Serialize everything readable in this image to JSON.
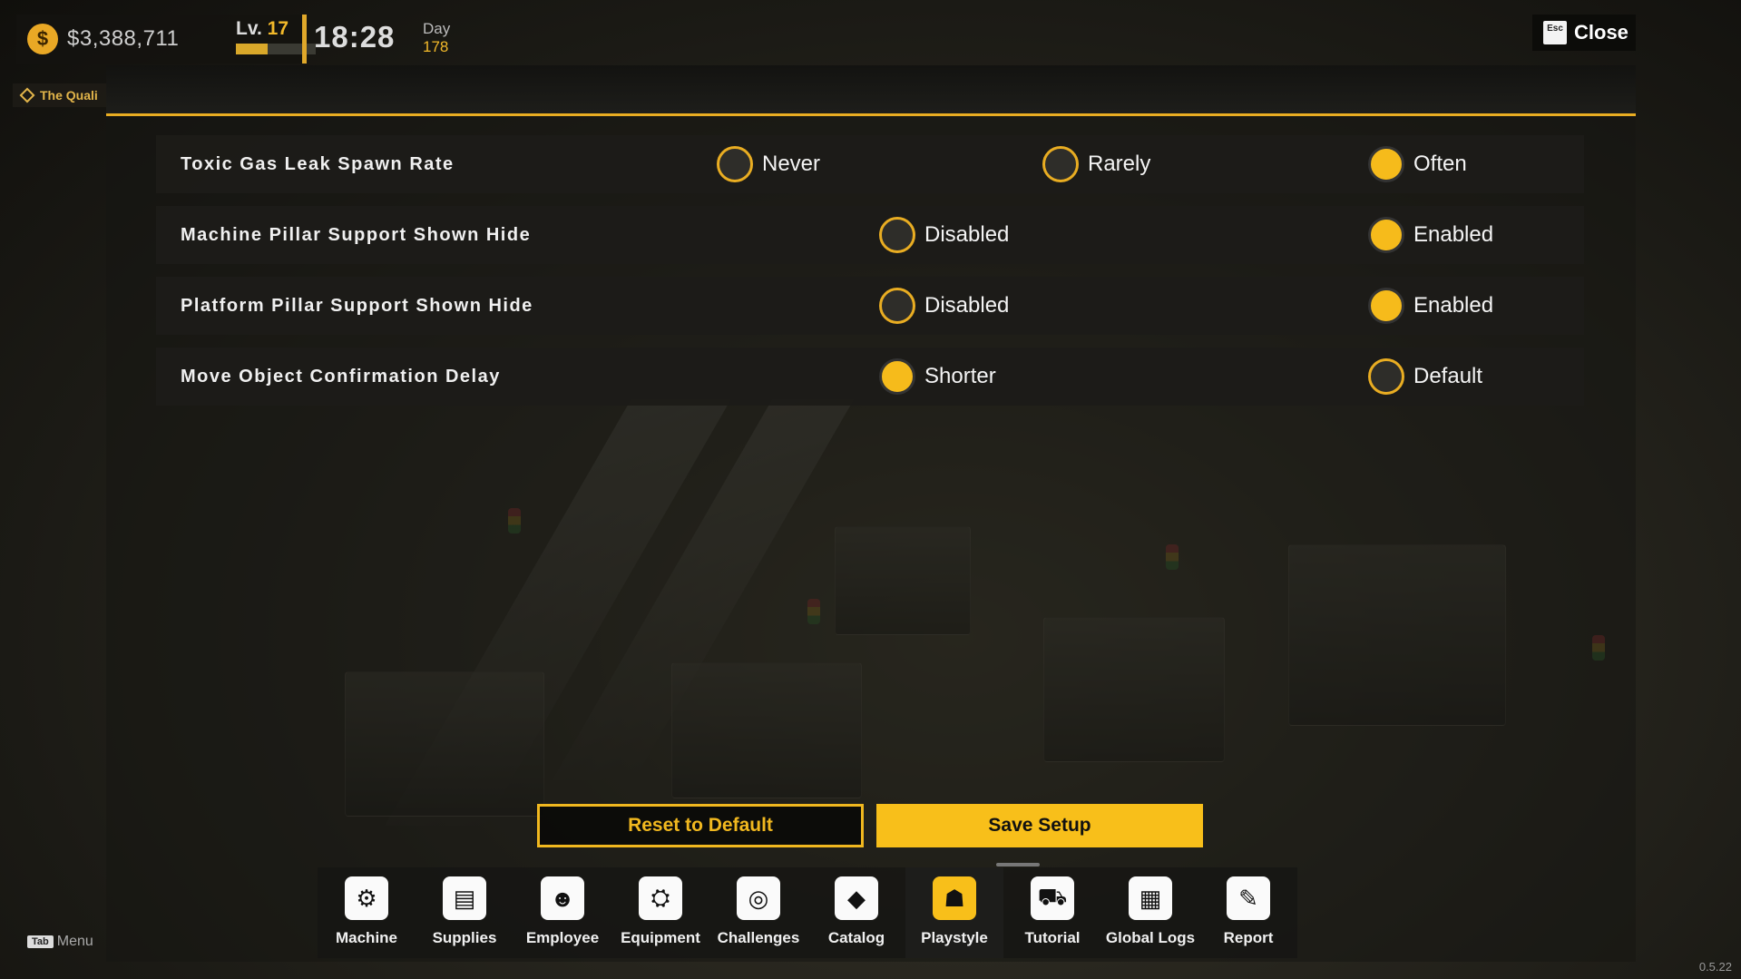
{
  "hud": {
    "money": "$3,388,711",
    "currency_symbol": "$",
    "level_prefix": "Lv.",
    "level": "17",
    "xp_progress": 0.4,
    "time": "18:28",
    "day_label": "Day",
    "day": "178",
    "quest": "The Quali",
    "close_key": "Esc",
    "close_label": "Close"
  },
  "settings": [
    {
      "label": "Toxic Gas Leak Spawn Rate",
      "options": [
        {
          "label": "Never",
          "selected": false
        },
        {
          "label": "Rarely",
          "selected": false
        },
        {
          "label": "Often",
          "selected": true
        }
      ]
    },
    {
      "label": "Machine Pillar Support Shown Hide",
      "options": [
        {
          "label": "Disabled",
          "selected": false
        },
        {
          "label": "Enabled",
          "selected": true
        }
      ]
    },
    {
      "label": "Platform Pillar Support Shown Hide",
      "options": [
        {
          "label": "Disabled",
          "selected": false
        },
        {
          "label": "Enabled",
          "selected": true
        }
      ]
    },
    {
      "label": "Move Object Confirmation Delay",
      "options": [
        {
          "label": "Shorter",
          "selected": true
        },
        {
          "label": "Default",
          "selected": false
        }
      ]
    }
  ],
  "buttons": {
    "reset": "Reset to Default",
    "save": "Save Setup"
  },
  "nav": [
    {
      "label": "Machine",
      "icon": "machine-icon",
      "glyph": "⚙",
      "active": false
    },
    {
      "label": "Supplies",
      "icon": "supplies-icon",
      "glyph": "▤",
      "active": false
    },
    {
      "label": "Employee",
      "icon": "employee-icon",
      "glyph": "☻",
      "active": false
    },
    {
      "label": "Equipment",
      "icon": "equipment-icon",
      "glyph": "⛭",
      "active": false
    },
    {
      "label": "Challenges",
      "icon": "challenges-icon",
      "glyph": "◎",
      "active": false
    },
    {
      "label": "Catalog",
      "icon": "diamond-icon",
      "glyph": "◆",
      "active": false
    },
    {
      "label": "Playstyle",
      "icon": "gamepad-icon",
      "glyph": "☗",
      "active": true
    },
    {
      "label": "Tutorial",
      "icon": "truck-icon",
      "glyph": "⛟",
      "active": false
    },
    {
      "label": "Global Logs",
      "icon": "logs-icon",
      "glyph": "▦",
      "active": false
    },
    {
      "label": "Report",
      "icon": "report-icon",
      "glyph": "✎",
      "active": false
    }
  ],
  "footer": {
    "tab_key": "Tab",
    "menu_label": "Menu",
    "version": "0.5.22"
  },
  "colors": {
    "accent": "#f6bb1b",
    "panel": "#1c1b18"
  }
}
